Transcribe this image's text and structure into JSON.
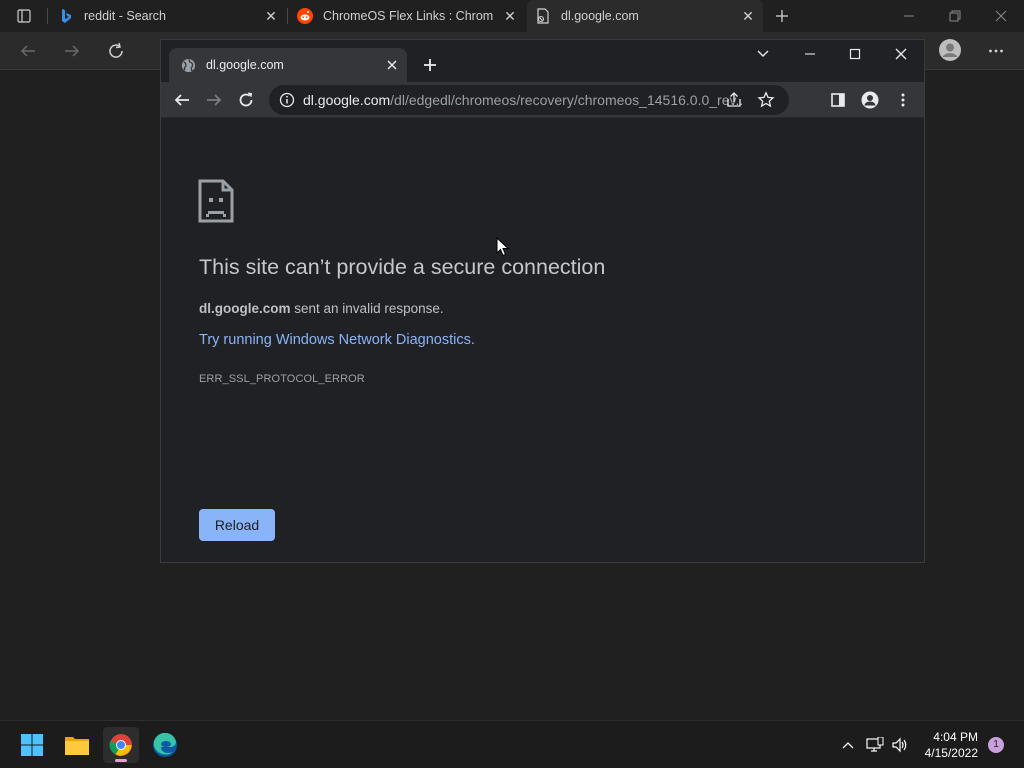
{
  "edge": {
    "tabs": [
      {
        "label": "reddit - Search",
        "icon": "bing-icon"
      },
      {
        "label": "ChromeOS Flex Links : ChromeO",
        "icon": "reddit-icon"
      },
      {
        "label": "dl.google.com",
        "icon": "page-error-icon"
      }
    ]
  },
  "chrome": {
    "tab": {
      "label": "dl.google.com"
    },
    "address": {
      "host": "dl.google.com",
      "path": "/dl/edgedl/chromeos/recovery/chromeos_14516.0.0_rev..."
    }
  },
  "error_page": {
    "heading": "This site can’t provide a secure connection",
    "summary_host": "dl.google.com",
    "summary_text": " sent an invalid response.",
    "link": "Try running Windows Network Diagnostics.",
    "code": "ERR_SSL_PROTOCOL_ERROR",
    "reload_label": "Reload"
  },
  "taskbar": {
    "time": "4:04 PM",
    "date": "4/15/2022",
    "notifications": "1"
  },
  "colors": {
    "link": "#8ab4f8",
    "accent_button": "#8ab4f8",
    "background": "#202124"
  }
}
